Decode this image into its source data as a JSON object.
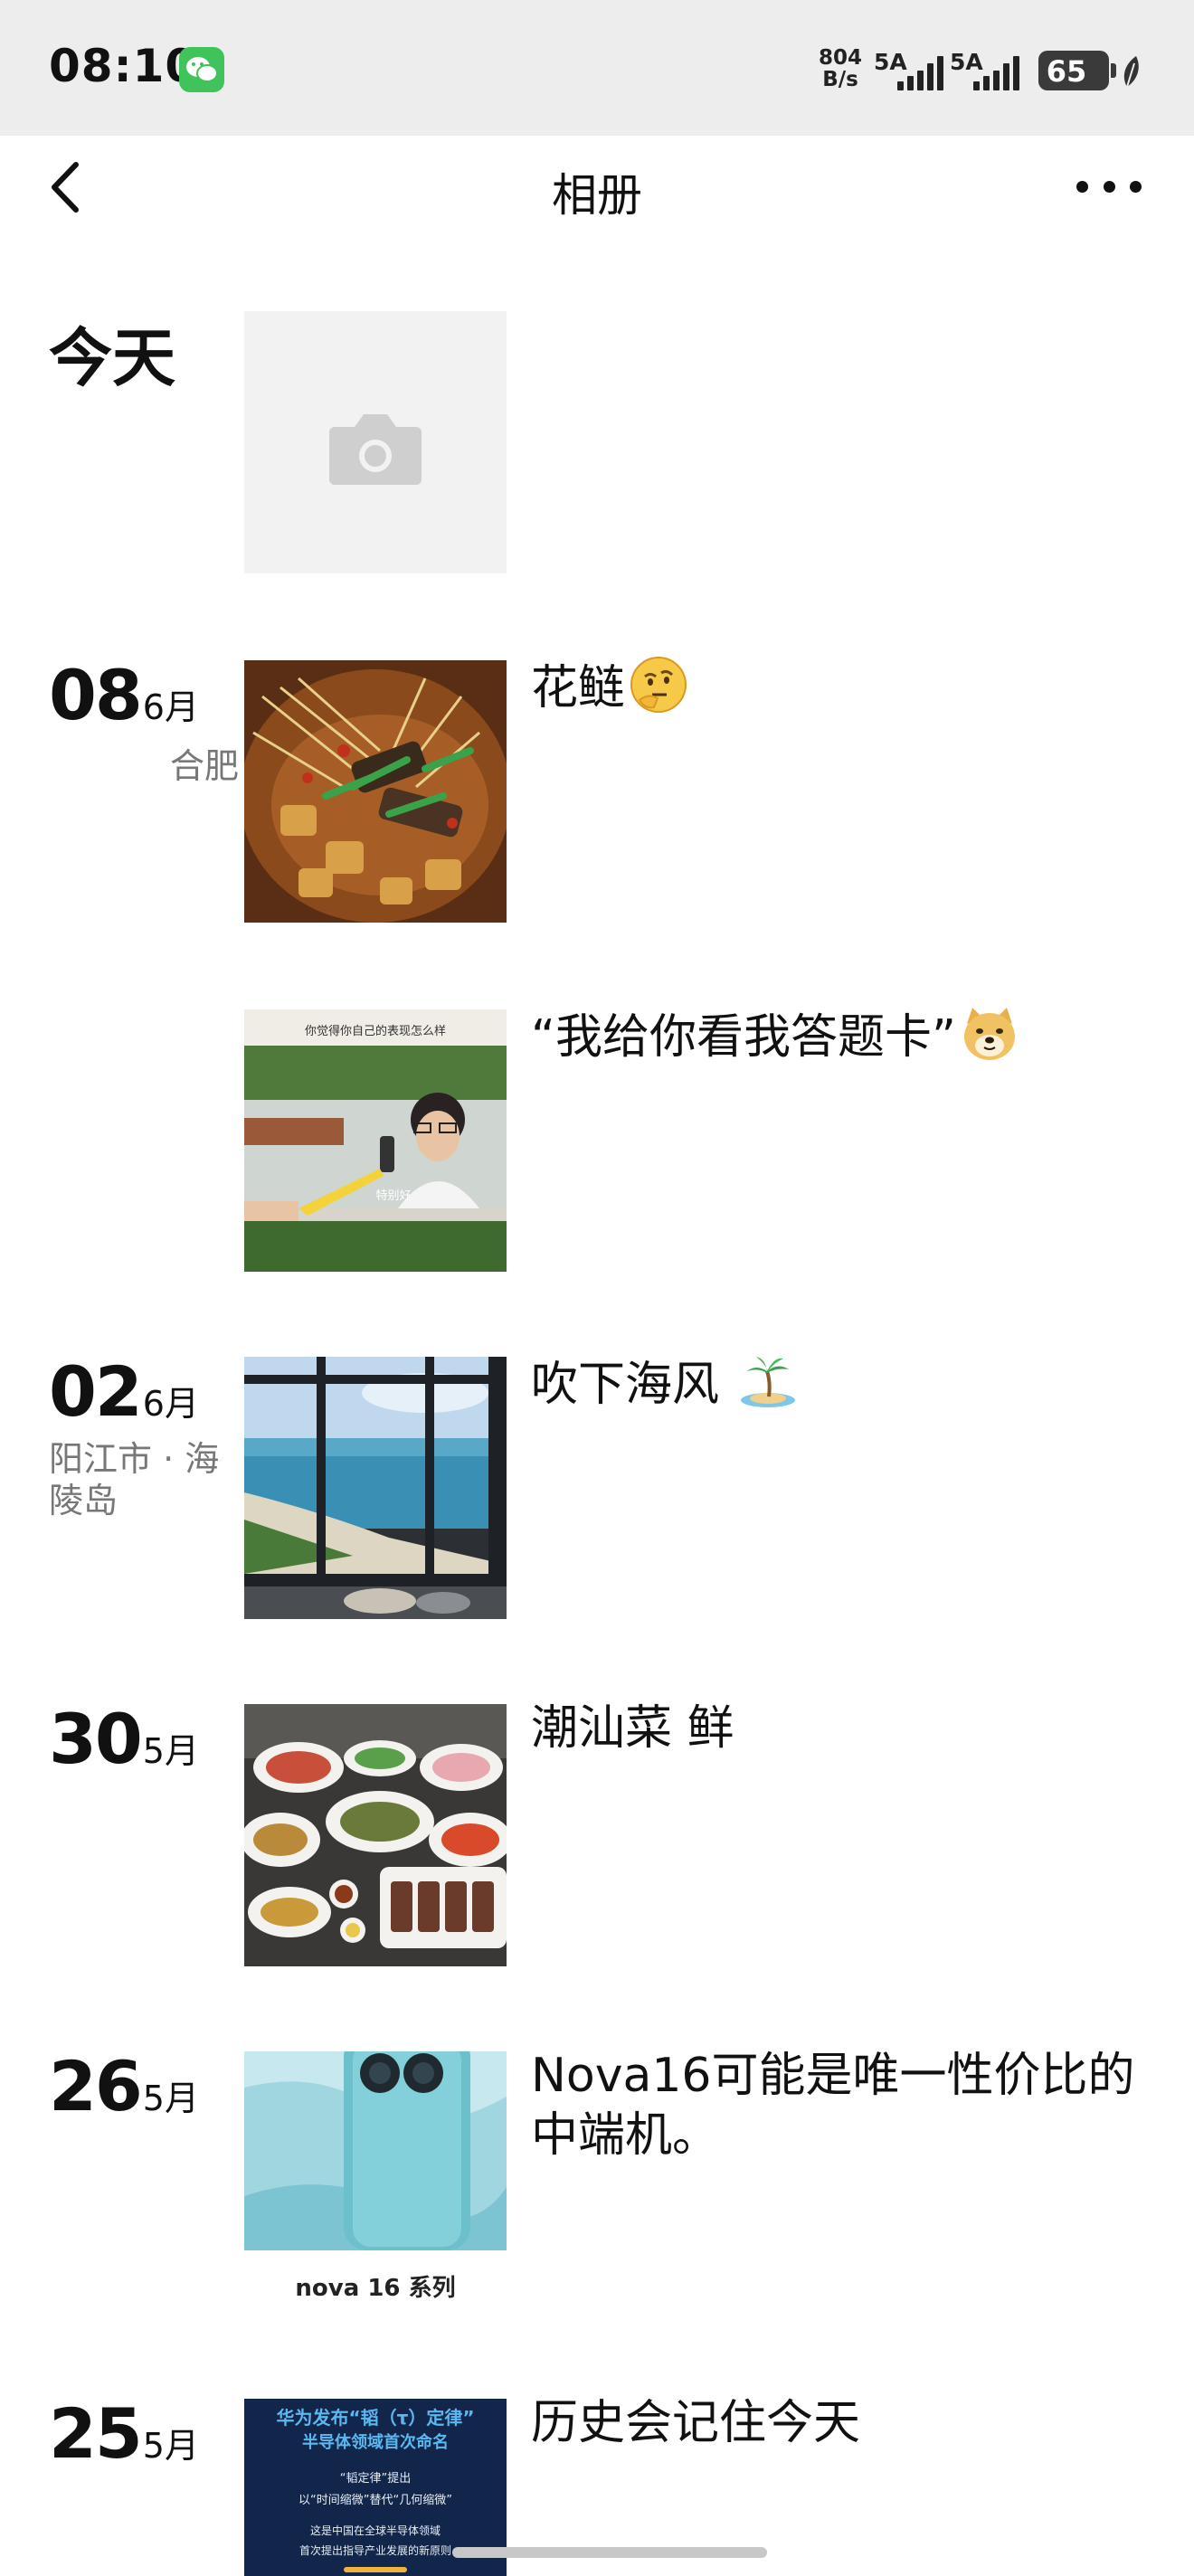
{
  "status_bar": {
    "time": "08:10",
    "net_speed_value": "804",
    "net_speed_unit": "B/s",
    "sim1": "5A",
    "sim2": "5A",
    "battery": "65"
  },
  "header": {
    "title": "相册"
  },
  "posts": [
    {
      "date_label": "今天",
      "location": "",
      "caption": ""
    },
    {
      "day": "08",
      "month": "6月",
      "location": "合肥",
      "caption": "花鲢"
    },
    {
      "day": "",
      "month": "",
      "location": "",
      "caption": "“我给你看我答题卡”",
      "thumb_text_top": "你觉得你自己的表现怎么样",
      "thumb_text_bottom": "特别好"
    },
    {
      "day": "02",
      "month": "6月",
      "location": "阳江市 · 海陵岛",
      "caption": "吹下海风"
    },
    {
      "day": "30",
      "month": "5月",
      "location": "",
      "caption": "潮汕菜 鲜"
    },
    {
      "day": "26",
      "month": "5月",
      "location": "",
      "caption": "Nova16可能是唯一性价比的中端机。",
      "thumb_brand": "nova 16 系列"
    },
    {
      "day": "25",
      "month": "5月",
      "location": "",
      "caption": "历史会记住今天",
      "thumb_headline": "华为发布“韬（τ）定律”",
      "thumb_subhead": "半导体领域首次命名",
      "thumb_line1": "“韬定律”提出",
      "thumb_line2": "以“时间缩微”替代“几何缩微”",
      "thumb_line3": "这是中国在全球半导体领域",
      "thumb_line4": "首次提出指导产业发展的新原则"
    }
  ],
  "colors": {
    "status_bar_bg": "#ededed",
    "wechat_green": "#3fc35a",
    "location_gray": "#777777"
  }
}
